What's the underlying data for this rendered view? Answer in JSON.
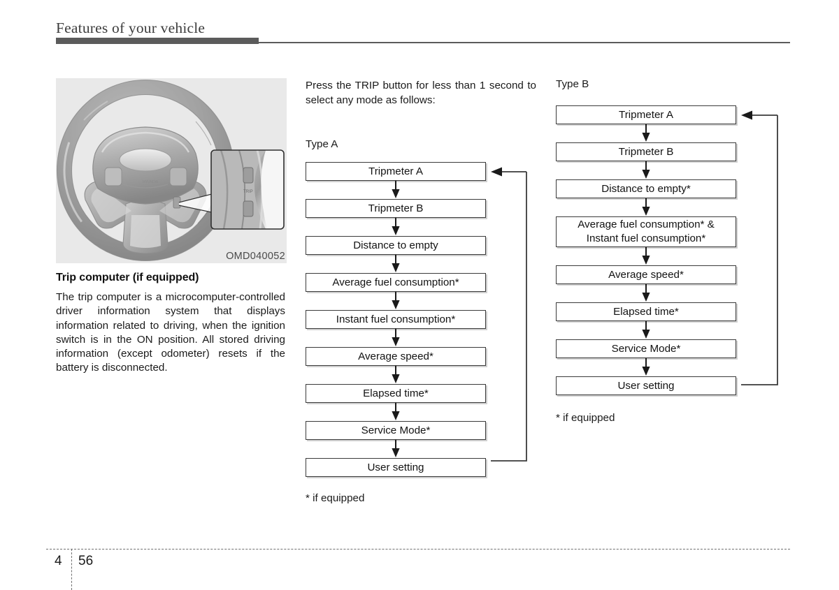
{
  "header": {
    "title": "Features of your vehicle"
  },
  "figure": {
    "caption": "OMD040052",
    "alt_name": "steering-wheel-with-trip-button-callout"
  },
  "left": {
    "heading": "Trip computer (if equipped)",
    "paragraph": "The trip computer is a microcomputer-controlled driver information system that displays information related to driving, when the ignition switch is in the ON position. All stored driving information (except odometer) resets if the battery is disconnected."
  },
  "middle": {
    "intro": "Press the TRIP button for less than 1 second to select any mode as follows:",
    "type_label": "Type A",
    "footnote": "* if equipped",
    "steps": [
      "Tripmeter A",
      "Tripmeter B",
      "Distance to empty",
      "Average fuel consumption*",
      "Instant fuel consumption*",
      "Average speed*",
      "Elapsed time*",
      "Service Mode*",
      "User setting"
    ]
  },
  "right": {
    "type_label": "Type B",
    "footnote": "* if equipped",
    "steps": [
      "Tripmeter A",
      "Tripmeter B",
      "Distance to empty*",
      "Average fuel consumption* &\nInstant fuel consumption*",
      "Average speed*",
      "Elapsed time*",
      "Service Mode*",
      "User setting"
    ]
  },
  "footer": {
    "chapter": "4",
    "page": "56"
  },
  "colors": {
    "rule": "#5b5b5b",
    "box_border": "#3a3a3a",
    "text": "#1a1a1a",
    "photo_bg": "#e9e9e9"
  }
}
